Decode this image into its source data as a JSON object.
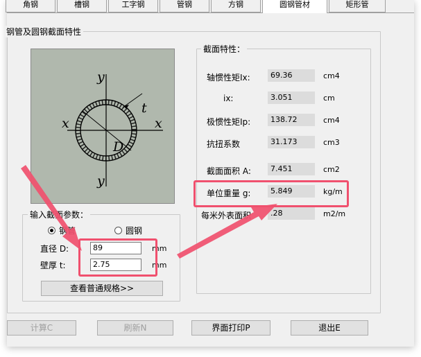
{
  "tabs": [
    "角钢",
    "槽钢",
    "工字钢",
    "管钢",
    "方钢",
    "圆钢管材",
    "矩形管"
  ],
  "main_group_title": "钢管及圆钢截面特性",
  "diagram_labels": {
    "y_top": "y",
    "y_bottom": "y",
    "x_left": "x",
    "x_right": "x",
    "t": "t",
    "D": "D"
  },
  "input_group": {
    "title": "输入截面参数：",
    "radio_tube": "钢管",
    "radio_rod": "圆钢",
    "diameter_label": "直径 D:",
    "diameter_value": "89",
    "diameter_unit": "mm",
    "thickness_label": "壁厚 t:",
    "thickness_value": "2.75",
    "thickness_unit": "mm",
    "spec_button": "查看普通规格>>"
  },
  "props": {
    "title": "截面特性：",
    "rows": [
      {
        "label": "轴惯性矩Ix:",
        "value": "69.36",
        "unit": "cm4"
      },
      {
        "label": "ix:",
        "value": "3.051",
        "unit": "cm"
      },
      {
        "label": "极惯性矩Ip:",
        "value": "138.72",
        "unit": "cm4"
      },
      {
        "label": "抗扭系数",
        "value": "31.173",
        "unit": "cm3"
      },
      {
        "label": "截面面积 A:",
        "value": "7.451",
        "unit": "cm2"
      },
      {
        "label": "单位重量 g:",
        "value": "5.849",
        "unit": "kg/m"
      },
      {
        "label": "每米外表面积",
        "value": ".28",
        "unit": "m2/m"
      }
    ]
  },
  "buttons": {
    "calc": "计算C",
    "refresh": "刷新N",
    "print": "界面打印P",
    "exit": "退出E"
  },
  "colors": {
    "highlight": "#f0506e",
    "diagram_bg": "#b0b8ad"
  }
}
